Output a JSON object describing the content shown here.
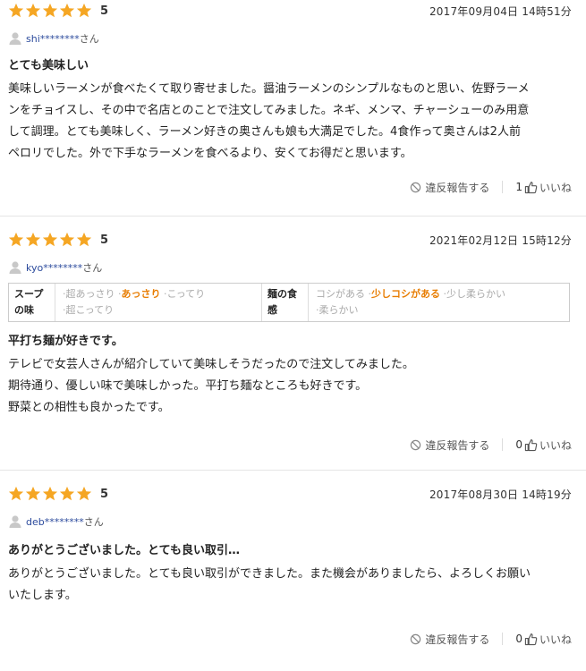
{
  "colors": {
    "star": "#f5a623",
    "user_link": "#2b4a9c",
    "selected": "#e87e04"
  },
  "reviews": [
    {
      "rating": "5",
      "date": "2017年09月04日 14時51分",
      "user": "shi********",
      "user_suffix": "さん",
      "title": "とても美味しい",
      "body": [
        "美味しいラーメンが食べたくて取り寄せました。醤油ラーメンのシンプルなものと思い、佐野ラーメ",
        "ンをチョイスし、その中で名店とのことで注文してみました。ネギ、メンマ、チャーシューのみ用意",
        "して調理。とても美味しく、ラーメン好きの奥さんも娘も大満足でした。4食作って奥さんは2人前",
        "ペロリでした。外で下手なラーメンを食べるより、安くてお得だと思います。"
      ],
      "report_label": "違反報告する",
      "like_count": "1",
      "like_label": "いいね"
    },
    {
      "rating": "5",
      "date": "2021年02月12日 15時12分",
      "user": "kyo********",
      "user_suffix": "さん",
      "attributes": {
        "soup_label": "スープの味",
        "soup_options": [
          "超あっさり",
          "あっさり",
          "こってり",
          "超こってり"
        ],
        "soup_selected": "あっさり",
        "noodle_label": "麺の食感",
        "noodle_options": [
          "コシがある",
          "少しコシがある",
          "少し柔らかい",
          "柔らかい"
        ],
        "noodle_selected": "少しコシがある"
      },
      "title": "平打ち麺が好きです。",
      "body": [
        "テレビで女芸人さんが紹介していて美味しそうだったので注文してみました。",
        "期待通り、優しい味で美味しかった。平打ち麺なところも好きです。",
        "野菜との相性も良かったです。"
      ],
      "report_label": "違反報告する",
      "like_count": "0",
      "like_label": "いいね"
    },
    {
      "rating": "5",
      "date": "2017年08月30日 14時19分",
      "user": "deb********",
      "user_suffix": "さん",
      "title": "ありがとうございました。とても良い取引…",
      "body": [
        "ありがとうございました。とても良い取引ができました。また機会がありましたら、よろしくお願い",
        "いたします。"
      ],
      "report_label": "違反報告する",
      "like_count": "0",
      "like_label": "いいね"
    }
  ]
}
